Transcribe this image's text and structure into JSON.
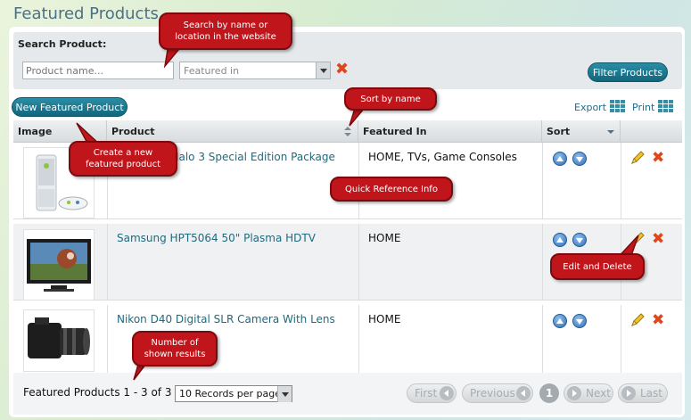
{
  "page": {
    "title": "Featured Products"
  },
  "search": {
    "label": "Search Product:",
    "product_placeholder": "Product name...",
    "featured_placeholder": "Featured in",
    "filter_label": "Filter Products"
  },
  "toolbar": {
    "new_label": "New Featured Product",
    "export_label": "Export",
    "print_label": "Print"
  },
  "table": {
    "columns": [
      "Image",
      "Product",
      "Featured In",
      "Sort"
    ],
    "rows": [
      {
        "product": "Xbox 360 Halo 3 Special Edition Package",
        "featured_in": "HOME, TVs, Game Consoles"
      },
      {
        "product": "Samsung HPT5064 50\" Plasma HDTV",
        "featured_in": "HOME"
      },
      {
        "product": "Nikon D40 Digital SLR Camera With Lens",
        "featured_in": "HOME"
      }
    ]
  },
  "footer": {
    "count_text": "Featured Products 1 - 3 of 3",
    "per_page": "10 Records per page",
    "first": "First",
    "previous": "Previous",
    "current_page": "1",
    "next": "Next",
    "last": "Last"
  },
  "callouts": {
    "search": "Search by name or location in the website",
    "sort": "Sort by name",
    "create": "Create a new featured product",
    "quick": "Quick Reference Info",
    "edit": "Edit and Delete",
    "results": "Number of shown results"
  },
  "colors": {
    "accent": "#1e6a7f",
    "delete": "#e2451c",
    "callout": "#c0151b"
  }
}
